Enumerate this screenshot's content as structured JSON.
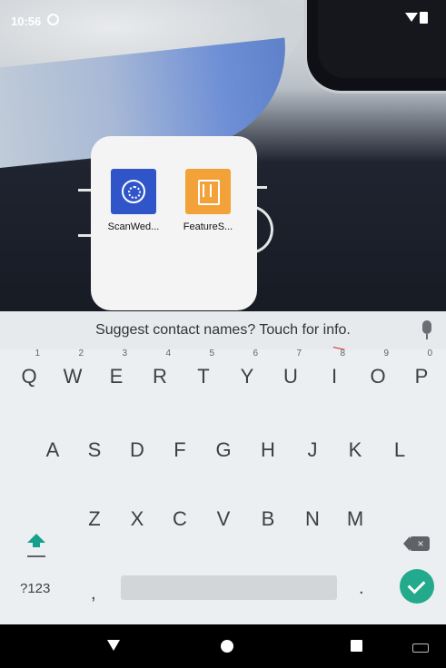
{
  "status": {
    "time": "10:56"
  },
  "folder": {
    "apps": [
      {
        "label": "ScanWed...",
        "icon": "scanwedge-icon",
        "color": "#2f55c9"
      },
      {
        "label": "FeatureS...",
        "icon": "featuresettings-icon",
        "color": "#f3a23a"
      }
    ]
  },
  "keyboard": {
    "suggestion": "Suggest contact names? Touch for info.",
    "row1": [
      {
        "key": "Q",
        "hint": "1"
      },
      {
        "key": "W",
        "hint": "2"
      },
      {
        "key": "E",
        "hint": "3"
      },
      {
        "key": "R",
        "hint": "4"
      },
      {
        "key": "T",
        "hint": "5"
      },
      {
        "key": "Y",
        "hint": "6"
      },
      {
        "key": "U",
        "hint": "7"
      },
      {
        "key": "I",
        "hint": "8"
      },
      {
        "key": "O",
        "hint": "9"
      },
      {
        "key": "P",
        "hint": "0"
      }
    ],
    "row2": [
      "A",
      "S",
      "D",
      "F",
      "G",
      "H",
      "J",
      "K",
      "L"
    ],
    "row3": [
      "Z",
      "X",
      "C",
      "V",
      "B",
      "N",
      "M"
    ],
    "symbols_label": "?123",
    "comma": ",",
    "period": ".",
    "accent": "#23a98b"
  },
  "navbar": {
    "icons": [
      "back-icon",
      "home-icon",
      "recents-icon",
      "keyboard-switch-icon"
    ]
  }
}
